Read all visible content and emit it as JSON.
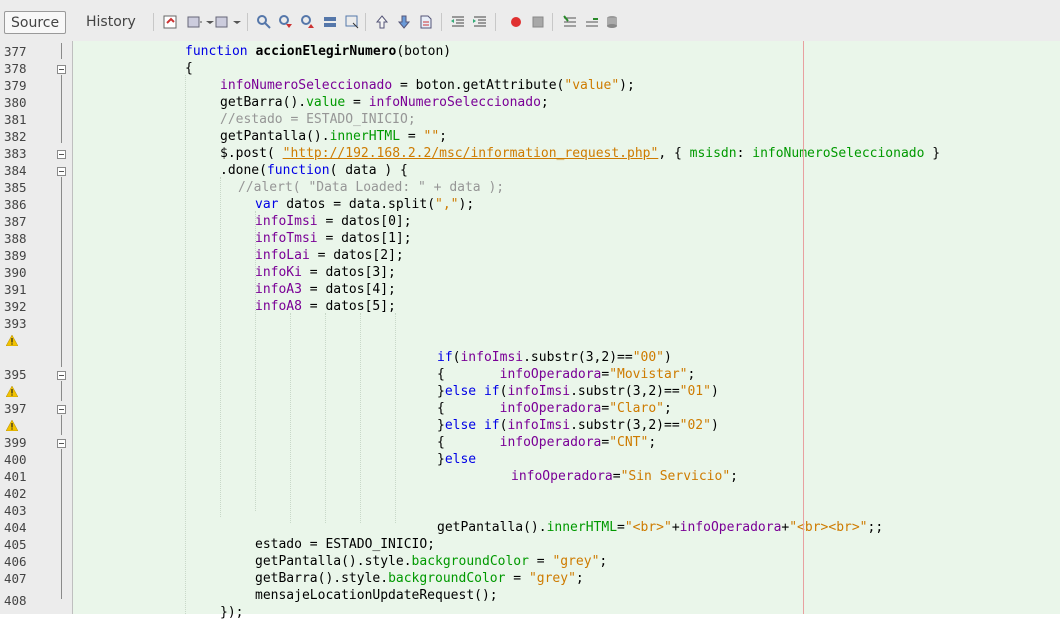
{
  "tabs": [
    {
      "label": "Source",
      "active": true
    },
    {
      "label": "History",
      "active": false
    }
  ],
  "toolbar_icons": [
    "last-edit-icon",
    "back-icon",
    "forward-icon",
    "find-selection-icon",
    "find-previous-icon",
    "find-next-icon",
    "toggle-highlight-icon",
    "toggle-rect-select-icon",
    "previous-bookmark-icon",
    "next-bookmark-icon",
    "toggle-bookmark-icon",
    "shift-left-icon",
    "shift-right-icon",
    "start-macro-icon",
    "stop-macro-icon",
    "comment-icon",
    "uncomment-icon",
    "database-icon"
  ],
  "line_numbers": [
    "377",
    "378",
    "379",
    "380",
    "381",
    "382",
    "383",
    "384",
    "385",
    "386",
    "387",
    "388",
    "389",
    "390",
    "391",
    "392",
    "393",
    "",
    "395",
    "",
    "397",
    "",
    "399",
    "400",
    "401",
    "402",
    "403",
    "404",
    "405",
    "406",
    "407",
    "408"
  ],
  "code": {
    "l377": {
      "kw": "function",
      "name": "accionElegirNumero",
      "rest": "(boton)"
    },
    "l378": "{",
    "l379": {
      "var": "infoNumeroSeleccionado",
      "mid": " = boton.getAttribute(",
      "str": "\"value\"",
      "end": ");"
    },
    "l380": {
      "a": "getBarra().",
      "fld": "value",
      "b": " = ",
      "var": "infoNumeroSeleccionado",
      "c": ";"
    },
    "l381": "//estado = ESTADO_INICIO;",
    "l382": {
      "a": "getPantalla().",
      "fld": "innerHTML",
      "b": " = ",
      "str": "\"\"",
      "c": ";"
    },
    "l383": {
      "a": "$.post( ",
      "url": "\"http://192.168.2.2/msc/information_request.php\"",
      "b": ", { ",
      "key": "msisdn",
      "c": ": ",
      "var": "infoNumeroSeleccionado",
      "d": " }"
    },
    "l384": {
      "a": ".done(",
      "kw": "function",
      "b": "( data ) {"
    },
    "l385": "//alert( \"Data Loaded: \" + data );",
    "l386": {
      "kw": "var",
      "a": " datos = data.split(",
      "str": "\",\"",
      "b": ");"
    },
    "l387": {
      "var": "infoImsi",
      "a": " = datos[0];"
    },
    "l388": {
      "var": "infoTmsi",
      "a": " = datos[1];"
    },
    "l389": {
      "var": "infoLai",
      "a": " = datos[2];"
    },
    "l390": {
      "var": "infoKi",
      "a": " = datos[3];"
    },
    "l391": {
      "var": "infoA3",
      "a": " = datos[4];"
    },
    "l392": {
      "var": "infoA8",
      "a": " = datos[5];"
    },
    "l394": {
      "kw": "if",
      "a": "(",
      "var": "infoImsi",
      "b": ".substr(3,2)==",
      "str": "\"00\"",
      "c": ")"
    },
    "l395": {
      "a": "{       ",
      "var": "infoOperadora",
      "b": "=",
      "str": "\"Movistar\"",
      "c": ";"
    },
    "l396": {
      "a": "}",
      "kw": "else if",
      "b": "(",
      "var": "infoImsi",
      "c": ".substr(3,2)==",
      "str": "\"01\"",
      "d": ")"
    },
    "l397": {
      "a": "{       ",
      "var": "infoOperadora",
      "b": "=",
      "str": "\"Claro\"",
      "c": ";"
    },
    "l398": {
      "a": "}",
      "kw": "else if",
      "b": "(",
      "var": "infoImsi",
      "c": ".substr(3,2)==",
      "str": "\"02\"",
      "d": ")"
    },
    "l399": {
      "a": "{       ",
      "var": "infoOperadora",
      "b": "=",
      "str": "\"CNT\"",
      "c": ";"
    },
    "l400": {
      "a": "}",
      "kw": "else"
    },
    "l401": {
      "var": "infoOperadora",
      "b": "=",
      "str": "\"Sin Servicio\"",
      "c": ";"
    },
    "l403": {
      "a": "getPantalla().",
      "fld": "innerHTML",
      "b": "=",
      "str1": "\"<br>\"",
      "c": "+",
      "var": "infoOperadora",
      "d": "+",
      "str2": "\"<br><br>\"",
      "e": ";;"
    },
    "l404": {
      "a": "estado = ESTADO_INICIO;"
    },
    "l405": {
      "a": "getPantalla().style.",
      "fld": "backgroundColor",
      "b": " = ",
      "str": "\"grey\"",
      "c": ";"
    },
    "l406": {
      "a": "getBarra().style.",
      "fld": "backgroundColor",
      "b": " = ",
      "str": "\"grey\"",
      "c": ";"
    },
    "l407": {
      "a": "mensajeLocationUpdateRequest();"
    },
    "l408": "});"
  }
}
